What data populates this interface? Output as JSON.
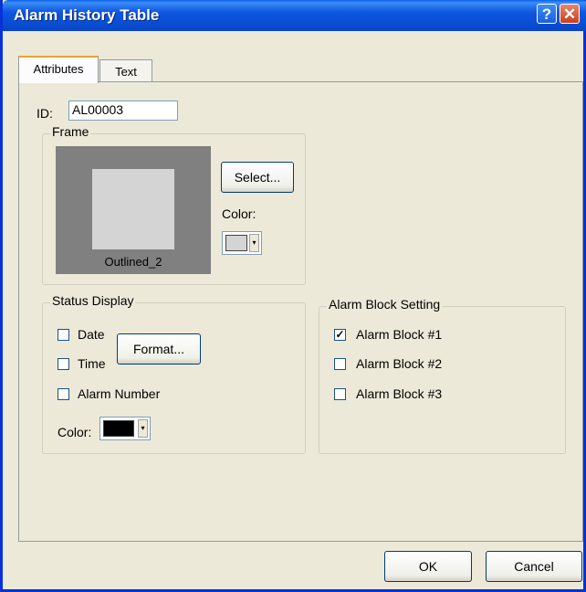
{
  "window": {
    "title": "Alarm History Table",
    "help_icon": "?",
    "close_icon": "✕"
  },
  "tabs": [
    {
      "label": "Attributes",
      "active": true
    },
    {
      "label": "Text",
      "active": false
    }
  ],
  "id_field": {
    "label": "ID:",
    "value": "AL00003"
  },
  "frame": {
    "title": "Frame",
    "preview_label": "Outlined_2",
    "select_label": "Select...",
    "color_label": "Color:",
    "color_value": "#d4d4d4"
  },
  "status_display": {
    "title": "Status Display",
    "date_label": "Date",
    "date_checked": false,
    "time_label": "Time",
    "time_checked": false,
    "alarm_number_label": "Alarm Number",
    "alarm_number_checked": false,
    "format_label": "Format...",
    "color_label": "Color:",
    "color_value": "#000000"
  },
  "alarm_block": {
    "title": "Alarm Block Setting",
    "items": [
      {
        "label": "Alarm Block #1",
        "checked": true
      },
      {
        "label": "Alarm Block #2",
        "checked": false
      },
      {
        "label": "Alarm Block #3",
        "checked": false
      }
    ]
  },
  "footer": {
    "ok_label": "OK",
    "cancel_label": "Cancel"
  },
  "colors": {
    "titlebar": "#0a4fd6",
    "dialog_bg": "#ece9d8",
    "tab_highlight": "#e8a335"
  }
}
